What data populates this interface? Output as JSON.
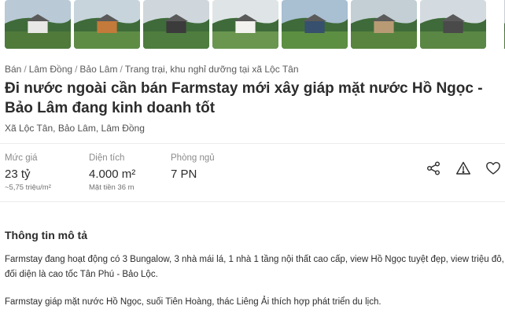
{
  "gallery": {
    "photos": [
      {
        "name": "photo-bungalow-hill",
        "sky": "#b9c9d6",
        "ground": "#4f7a3a",
        "feature": "#e8e8e6"
      },
      {
        "name": "photo-mural-wall",
        "sky": "#c7d4dc",
        "ground": "#5e8c45",
        "feature": "#c47a3a"
      },
      {
        "name": "photo-people-lake",
        "sky": "#cfd7dc",
        "ground": "#4e7d3f",
        "feature": "#3b3b3b"
      },
      {
        "name": "photo-cafe-house",
        "sky": "#dfe5e6",
        "ground": "#6b9650",
        "feature": "#f4f2ee"
      },
      {
        "name": "photo-lakeside-lawn",
        "sky": "#a9bfd2",
        "ground": "#5d8f43",
        "feature": "#36506e"
      },
      {
        "name": "photo-garden-huts",
        "sky": "#c3cfd4",
        "ground": "#58843f",
        "feature": "#b89b74"
      },
      {
        "name": "photo-cabins-path",
        "sky": "#d3dbe0",
        "ground": "#5a8744",
        "feature": "#4a4a4a"
      },
      {
        "name": "photo-partial",
        "sky": "#c7d1d8",
        "ground": "#4d7a3b",
        "feature": "#2e2e2e"
      }
    ]
  },
  "breadcrumb": {
    "items": [
      "Bán",
      "Lâm Đồng",
      "Bảo Lâm",
      "Trang trại, khu nghỉ dưỡng tại xã Lộc Tân"
    ],
    "separator": "/"
  },
  "listing": {
    "title": "Đi nước ngoài cần bán Farmstay mới xây giáp mặt nước Hồ Ngọc - Bảo Lâm đang kinh doanh tốt",
    "address": "Xã Lộc Tân, Bảo Lâm, Lâm Đồng"
  },
  "stats": {
    "price": {
      "label": "Mức giá",
      "value": "23 tỷ",
      "sub": "~5,75 triệu/m²"
    },
    "area": {
      "label": "Diện tích",
      "value": "4.000 m²",
      "sub": "Mặt tiền 36 m"
    },
    "bedrooms": {
      "label": "Phòng ngủ",
      "value": "7 PN"
    }
  },
  "actions": {
    "icons": [
      "share-icon",
      "report-icon",
      "favorite-icon"
    ],
    "color": "#2c2c2c"
  },
  "description": {
    "heading": "Thông tin mô tả",
    "paragraphs": [
      "Farmstay đang hoạt động có 3 Bungalow, 3 nhà mái lá, 1 nhà 1 tầng nội thất cao cấp, view Hồ Ngọc tuyệt đẹp, view triệu đô, đối diện là cao tốc Tân Phú - Bảo Lộc.",
      "Farmstay giáp mặt nước Hồ Ngọc, suối Tiên Hoàng, thác Liêng Ải thích hợp phát triển du lịch."
    ]
  }
}
